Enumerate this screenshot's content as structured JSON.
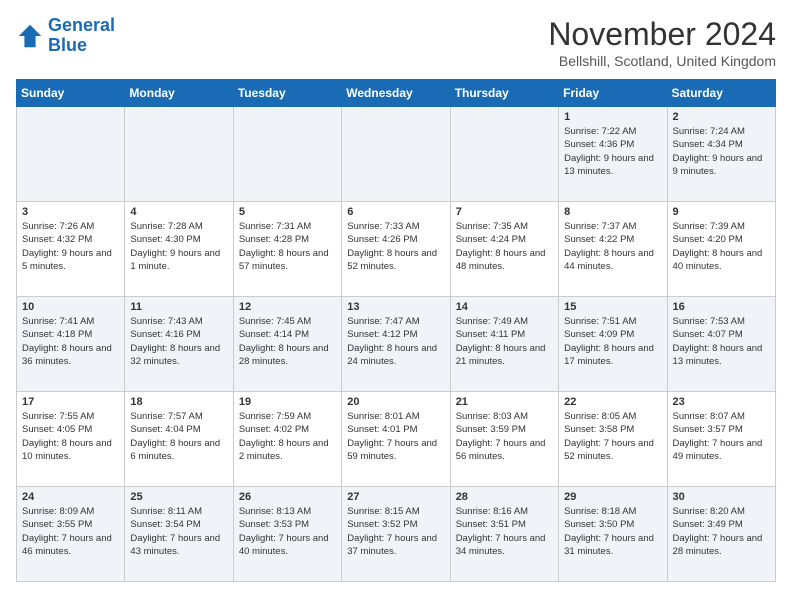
{
  "logo": {
    "text_general": "General",
    "text_blue": "Blue"
  },
  "header": {
    "month": "November 2024",
    "location": "Bellshill, Scotland, United Kingdom"
  },
  "days_of_week": [
    "Sunday",
    "Monday",
    "Tuesday",
    "Wednesday",
    "Thursday",
    "Friday",
    "Saturday"
  ],
  "weeks": [
    [
      {
        "day": "",
        "info": ""
      },
      {
        "day": "",
        "info": ""
      },
      {
        "day": "",
        "info": ""
      },
      {
        "day": "",
        "info": ""
      },
      {
        "day": "",
        "info": ""
      },
      {
        "day": "1",
        "info": "Sunrise: 7:22 AM\nSunset: 4:36 PM\nDaylight: 9 hours and 13 minutes."
      },
      {
        "day": "2",
        "info": "Sunrise: 7:24 AM\nSunset: 4:34 PM\nDaylight: 9 hours and 9 minutes."
      }
    ],
    [
      {
        "day": "3",
        "info": "Sunrise: 7:26 AM\nSunset: 4:32 PM\nDaylight: 9 hours and 5 minutes."
      },
      {
        "day": "4",
        "info": "Sunrise: 7:28 AM\nSunset: 4:30 PM\nDaylight: 9 hours and 1 minute."
      },
      {
        "day": "5",
        "info": "Sunrise: 7:31 AM\nSunset: 4:28 PM\nDaylight: 8 hours and 57 minutes."
      },
      {
        "day": "6",
        "info": "Sunrise: 7:33 AM\nSunset: 4:26 PM\nDaylight: 8 hours and 52 minutes."
      },
      {
        "day": "7",
        "info": "Sunrise: 7:35 AM\nSunset: 4:24 PM\nDaylight: 8 hours and 48 minutes."
      },
      {
        "day": "8",
        "info": "Sunrise: 7:37 AM\nSunset: 4:22 PM\nDaylight: 8 hours and 44 minutes."
      },
      {
        "day": "9",
        "info": "Sunrise: 7:39 AM\nSunset: 4:20 PM\nDaylight: 8 hours and 40 minutes."
      }
    ],
    [
      {
        "day": "10",
        "info": "Sunrise: 7:41 AM\nSunset: 4:18 PM\nDaylight: 8 hours and 36 minutes."
      },
      {
        "day": "11",
        "info": "Sunrise: 7:43 AM\nSunset: 4:16 PM\nDaylight: 8 hours and 32 minutes."
      },
      {
        "day": "12",
        "info": "Sunrise: 7:45 AM\nSunset: 4:14 PM\nDaylight: 8 hours and 28 minutes."
      },
      {
        "day": "13",
        "info": "Sunrise: 7:47 AM\nSunset: 4:12 PM\nDaylight: 8 hours and 24 minutes."
      },
      {
        "day": "14",
        "info": "Sunrise: 7:49 AM\nSunset: 4:11 PM\nDaylight: 8 hours and 21 minutes."
      },
      {
        "day": "15",
        "info": "Sunrise: 7:51 AM\nSunset: 4:09 PM\nDaylight: 8 hours and 17 minutes."
      },
      {
        "day": "16",
        "info": "Sunrise: 7:53 AM\nSunset: 4:07 PM\nDaylight: 8 hours and 13 minutes."
      }
    ],
    [
      {
        "day": "17",
        "info": "Sunrise: 7:55 AM\nSunset: 4:05 PM\nDaylight: 8 hours and 10 minutes."
      },
      {
        "day": "18",
        "info": "Sunrise: 7:57 AM\nSunset: 4:04 PM\nDaylight: 8 hours and 6 minutes."
      },
      {
        "day": "19",
        "info": "Sunrise: 7:59 AM\nSunset: 4:02 PM\nDaylight: 8 hours and 2 minutes."
      },
      {
        "day": "20",
        "info": "Sunrise: 8:01 AM\nSunset: 4:01 PM\nDaylight: 7 hours and 59 minutes."
      },
      {
        "day": "21",
        "info": "Sunrise: 8:03 AM\nSunset: 3:59 PM\nDaylight: 7 hours and 56 minutes."
      },
      {
        "day": "22",
        "info": "Sunrise: 8:05 AM\nSunset: 3:58 PM\nDaylight: 7 hours and 52 minutes."
      },
      {
        "day": "23",
        "info": "Sunrise: 8:07 AM\nSunset: 3:57 PM\nDaylight: 7 hours and 49 minutes."
      }
    ],
    [
      {
        "day": "24",
        "info": "Sunrise: 8:09 AM\nSunset: 3:55 PM\nDaylight: 7 hours and 46 minutes."
      },
      {
        "day": "25",
        "info": "Sunrise: 8:11 AM\nSunset: 3:54 PM\nDaylight: 7 hours and 43 minutes."
      },
      {
        "day": "26",
        "info": "Sunrise: 8:13 AM\nSunset: 3:53 PM\nDaylight: 7 hours and 40 minutes."
      },
      {
        "day": "27",
        "info": "Sunrise: 8:15 AM\nSunset: 3:52 PM\nDaylight: 7 hours and 37 minutes."
      },
      {
        "day": "28",
        "info": "Sunrise: 8:16 AM\nSunset: 3:51 PM\nDaylight: 7 hours and 34 minutes."
      },
      {
        "day": "29",
        "info": "Sunrise: 8:18 AM\nSunset: 3:50 PM\nDaylight: 7 hours and 31 minutes."
      },
      {
        "day": "30",
        "info": "Sunrise: 8:20 AM\nSunset: 3:49 PM\nDaylight: 7 hours and 28 minutes."
      }
    ]
  ]
}
